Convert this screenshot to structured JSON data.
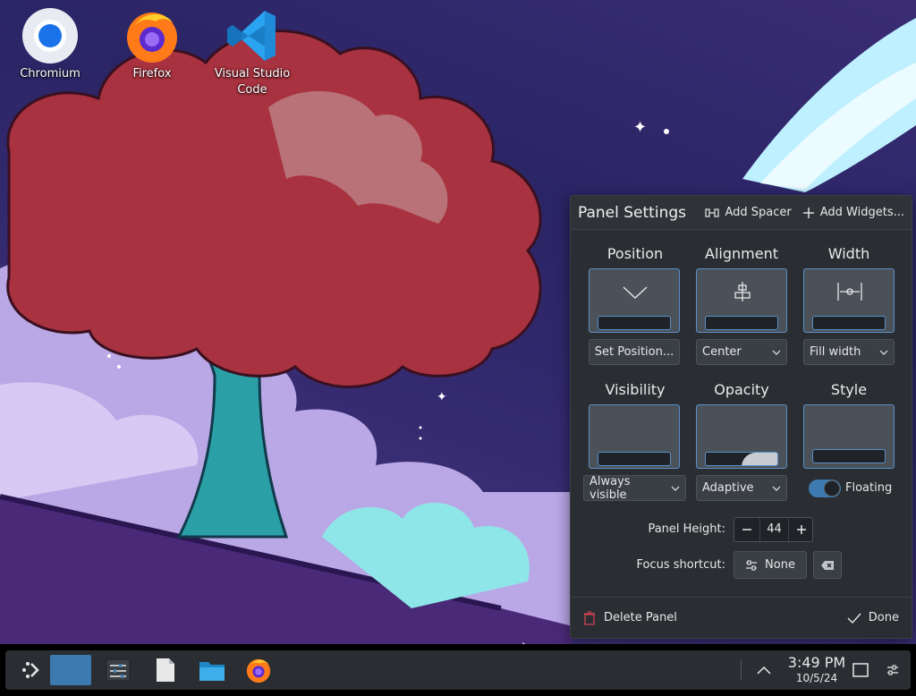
{
  "desktop": {
    "icons": [
      {
        "label": "Chromium",
        "icon": "chromium-icon"
      },
      {
        "label": "Firefox",
        "icon": "firefox-icon"
      },
      {
        "label": "Visual Studio Code",
        "icon": "vscode-icon"
      }
    ]
  },
  "panel_settings": {
    "title": "Panel Settings",
    "add_spacer": "Add Spacer",
    "add_widgets": "Add Widgets...",
    "position": {
      "label": "Position",
      "button": "Set Position..."
    },
    "alignment": {
      "label": "Alignment",
      "value": "Center"
    },
    "width": {
      "label": "Width",
      "value": "Fill width"
    },
    "visibility": {
      "label": "Visibility",
      "value": "Always visible"
    },
    "opacity": {
      "label": "Opacity",
      "value": "Adaptive"
    },
    "style": {
      "label": "Style",
      "toggle_label": "Floating",
      "floating": true
    },
    "panel_height": {
      "label": "Panel Height:",
      "value": "44"
    },
    "focus_shortcut": {
      "label": "Focus shortcut:",
      "value": "None"
    },
    "delete_panel": "Delete Panel",
    "done": "Done"
  },
  "taskbar": {
    "items": [
      "app-launcher-icon",
      "pager-icon",
      "system-settings-icon",
      "text-editor-icon",
      "file-manager-icon",
      "firefox-icon"
    ],
    "clock": {
      "time": "3:49 PM",
      "date": "10/5/24"
    },
    "tray": [
      "show-hidden-icon",
      "show-desktop-icon",
      "panel-config-icon"
    ]
  },
  "colors": {
    "accent": "#3d7ab0",
    "dialog_bg": "#2a2e32",
    "taskbar_bg": "#2a2e32"
  }
}
